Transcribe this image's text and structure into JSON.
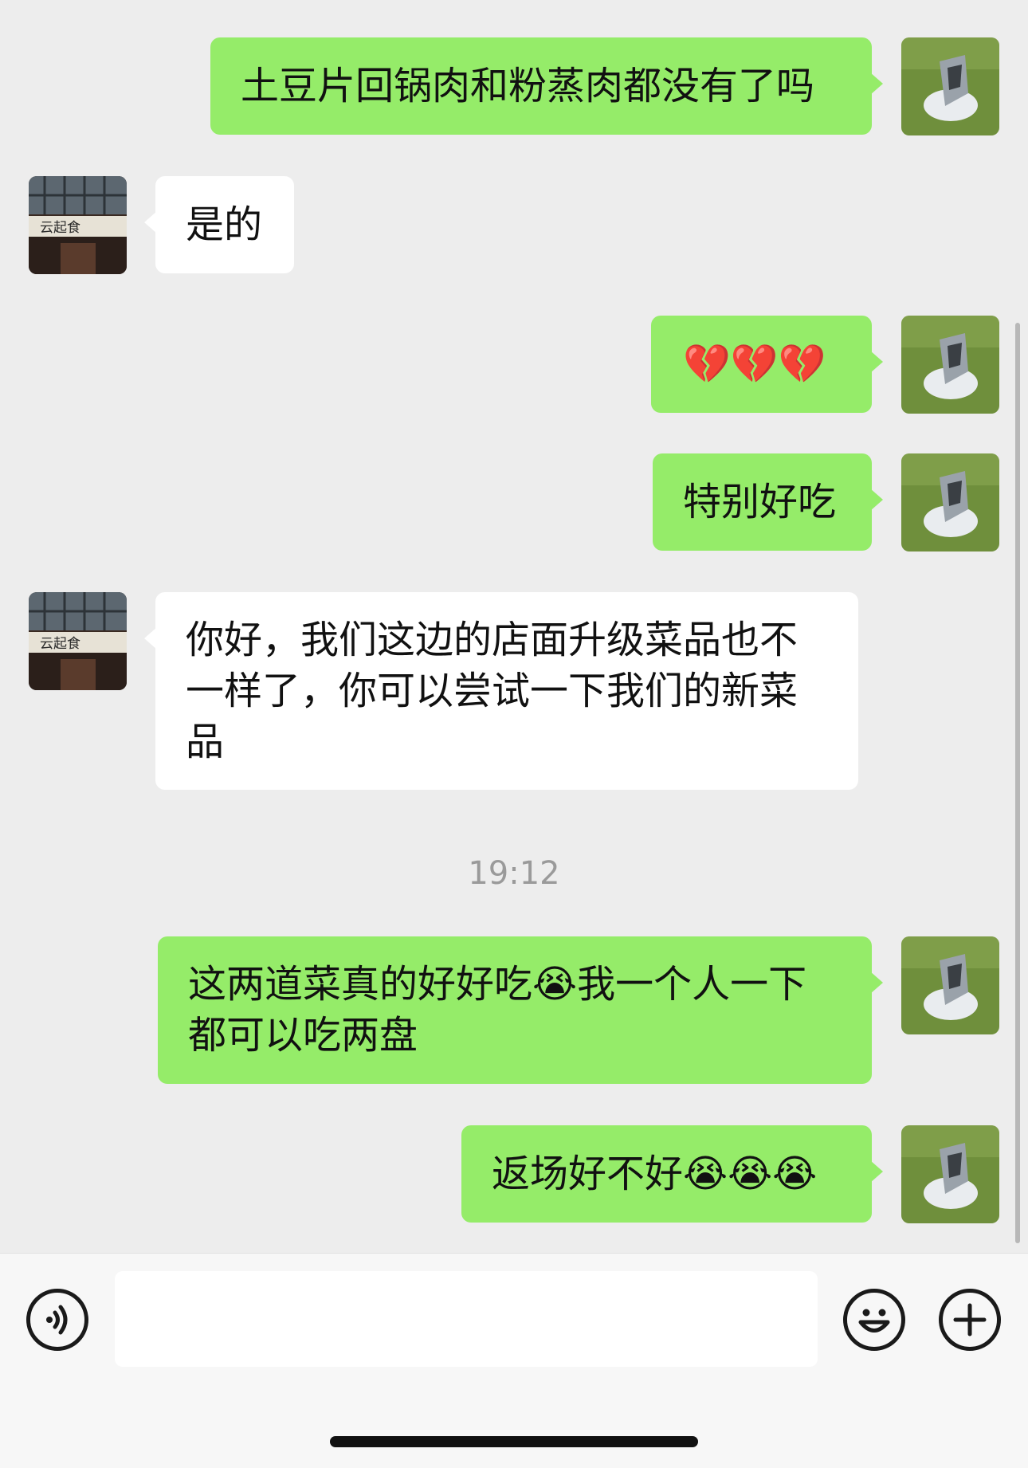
{
  "messages": [
    {
      "dir": "out",
      "text": "土豆片回锅肉和粉蒸肉都没有了吗"
    },
    {
      "dir": "in",
      "text": "是的"
    },
    {
      "dir": "out",
      "text": "💔💔💔"
    },
    {
      "dir": "out",
      "text": "特别好吃"
    },
    {
      "dir": "in",
      "text": "你好，我们这边的店面升级菜品也不一样了，你可以尝试一下我们的新菜品"
    },
    {
      "dir": "out",
      "text": "这两道菜真的好好吃😭我一个人一下都可以吃两盘"
    },
    {
      "dir": "out",
      "text": "返场好不好😭😭😭"
    }
  ],
  "timestamp": "19:12",
  "merchant_sign_text": "云起食",
  "input": {
    "value": "",
    "placeholder": ""
  },
  "icons": {
    "voice": "voice-icon",
    "emoji": "emoji-icon",
    "more": "plus-icon"
  },
  "colors": {
    "outgoing_bubble": "#95ec69",
    "incoming_bubble": "#ffffff",
    "chat_background": "#ededed"
  }
}
